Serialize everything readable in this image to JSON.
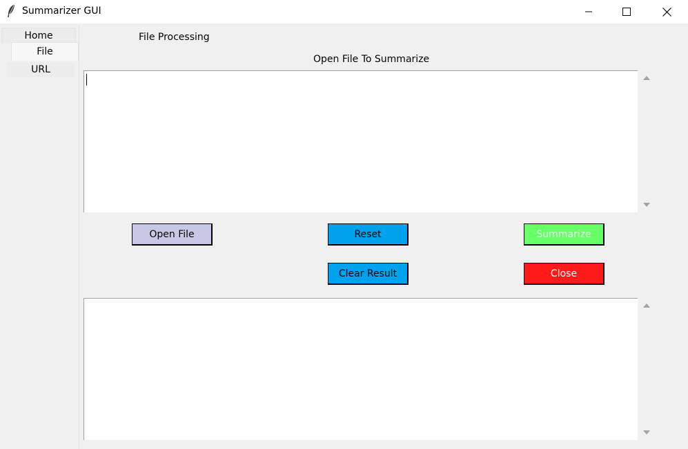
{
  "window": {
    "title": "Summarizer GUI",
    "icon": "feather-icon"
  },
  "tabs": [
    {
      "label": "Home"
    },
    {
      "label": "File"
    },
    {
      "label": "URL"
    }
  ],
  "panel": {
    "heading": "File Processing",
    "subheading": "Open File To Summarize"
  },
  "buttons": {
    "open_file": {
      "label": "Open File",
      "color": "#c8c8e6"
    },
    "reset": {
      "label": "Reset",
      "color": "#00a2ed"
    },
    "summarize": {
      "label": "Summarize",
      "color": "#66ff66"
    },
    "clear_result": {
      "label": "Clear Result",
      "color": "#00a2ed"
    },
    "close": {
      "label": "Close",
      "color": "#ff1a1a"
    }
  },
  "input_text": "",
  "result_text": ""
}
